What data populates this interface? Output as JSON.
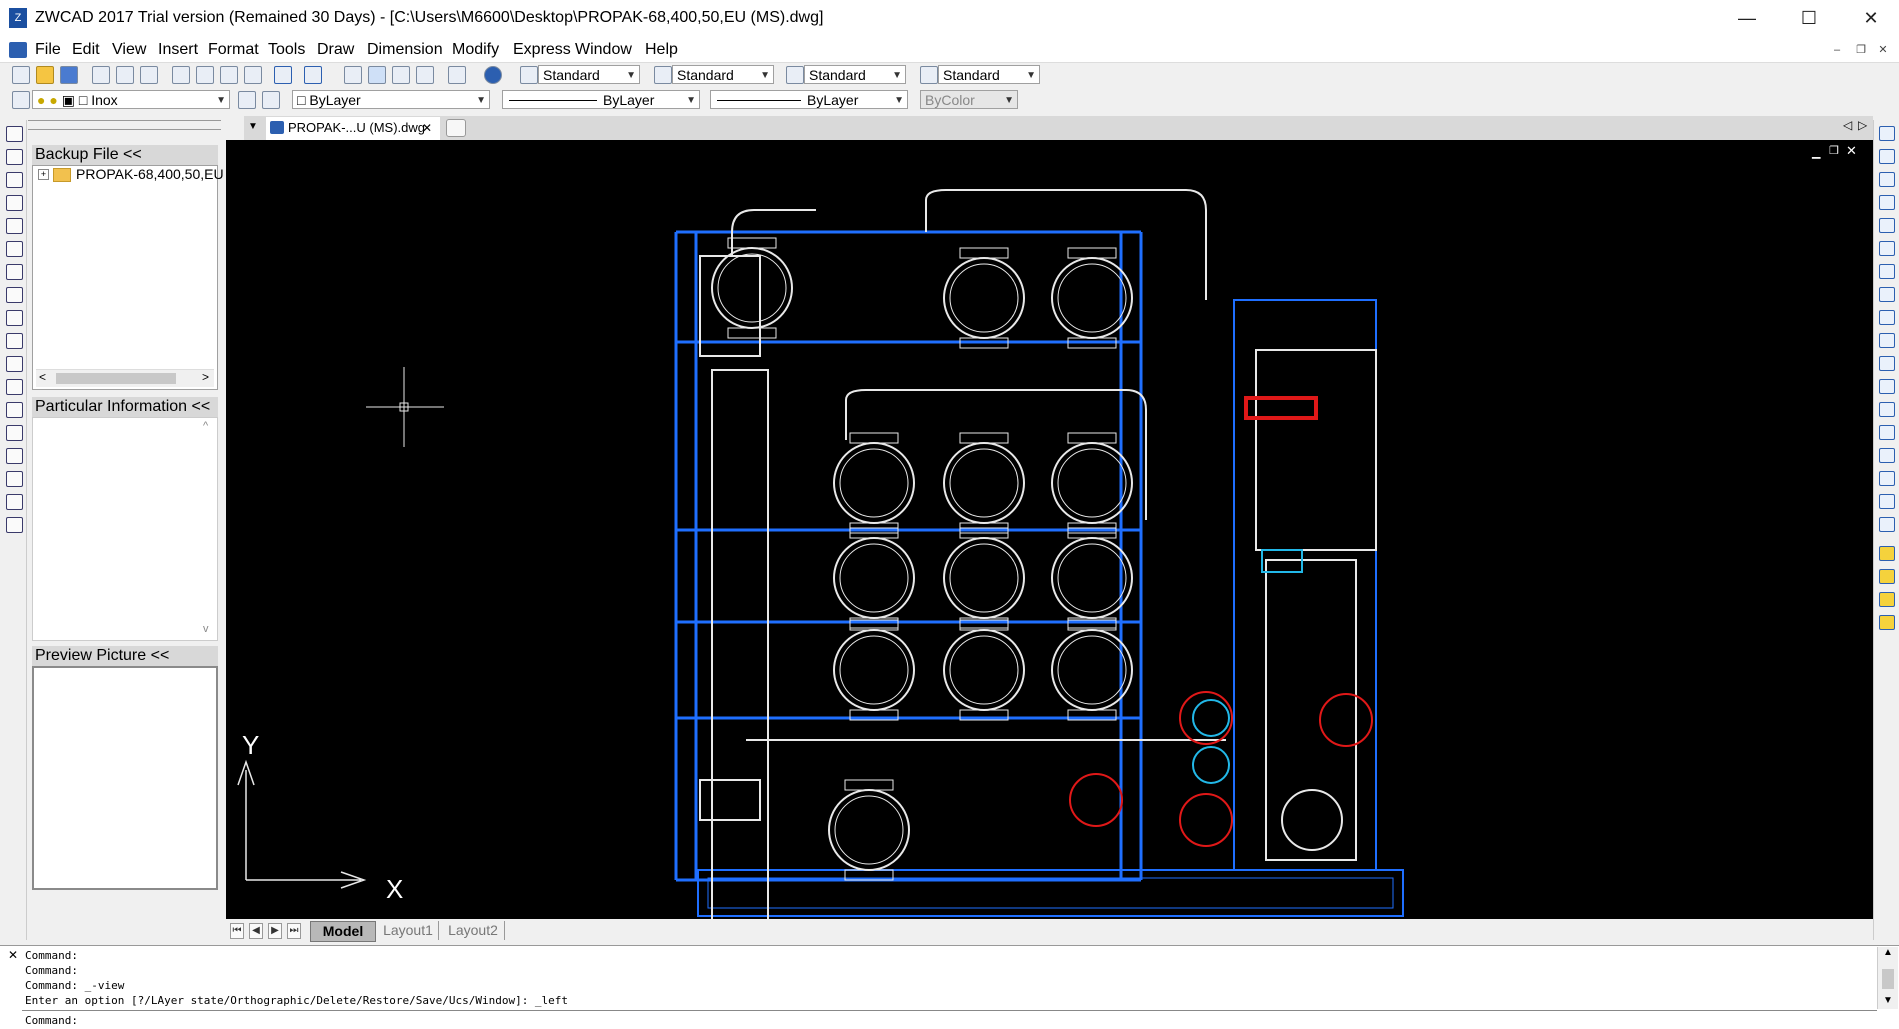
{
  "window": {
    "title": "ZWCAD 2017 Trial version (Remained 30 Days) - [C:\\Users\\M6600\\Desktop\\PROPAK-68,400,50,EU (MS).dwg]",
    "minimize": "—",
    "maximize": "☐",
    "close": "✕"
  },
  "menu": [
    "File",
    "Edit",
    "View",
    "Insert",
    "Format",
    "Tools",
    "Draw",
    "Dimension",
    "Modify",
    "Express",
    "Window",
    "Help"
  ],
  "styles": {
    "text_style": "Standard",
    "dim_style": "Standard",
    "table_style": "Standard",
    "mleader_style": "Standard"
  },
  "layers": {
    "current_layer": "Inox",
    "color": "ByLayer",
    "linetype": "ByLayer",
    "lineweight": "ByLayer",
    "plotstyle": "ByColor"
  },
  "left_panel": {
    "backup_header": "Backup File <<",
    "tree_item": "PROPAK-68,400,50,EU",
    "particular_header": "Particular Information <<",
    "preview_header": "Preview Picture <<"
  },
  "doc_tab": {
    "label": "PROPAK-...U (MS).dwg",
    "close": "✕"
  },
  "layout_tabs": [
    "Model",
    "Layout1",
    "Layout2"
  ],
  "ucs": {
    "x_label": "X",
    "y_label": "Y"
  },
  "command": {
    "lines": [
      "Command:",
      "Command:",
      "Command: _-view",
      "Enter an option [?/LAyer state/Orthographic/Delete/Restore/Save/Ucs/Window]: _left"
    ],
    "prompt": "Command:"
  },
  "colors": {
    "canvas_bg": "#000000",
    "frame_blue": "#1f6fff",
    "drawing_white": "#e8e8e8",
    "drawing_red": "#e01818",
    "drawing_cyan": "#22b8e8"
  },
  "icons": {
    "app": "zwcad-logo-icon",
    "draw_tools": [
      "line-icon",
      "xline-icon",
      "polyline-icon",
      "polygon-icon",
      "rectangle-icon",
      "arc-icon",
      "circle-icon",
      "cloud-icon",
      "spline-icon",
      "ellipse-icon",
      "ellipse-arc-icon",
      "insert-block-icon",
      "make-block-icon",
      "point-icon",
      "hatch-icon",
      "region-icon",
      "table-icon",
      "mtext-icon"
    ],
    "modify_tools": [
      "erase-icon",
      "copy-icon",
      "mirror-icon",
      "offset-icon",
      "array-icon",
      "move-icon",
      "rotate-icon",
      "scale-icon",
      "stretch-icon",
      "trim-icon",
      "extend-icon",
      "break-icon",
      "break-at-point-icon",
      "join-icon",
      "chamfer-icon",
      "fillet-icon",
      "explode-icon",
      "edit-icon"
    ]
  }
}
